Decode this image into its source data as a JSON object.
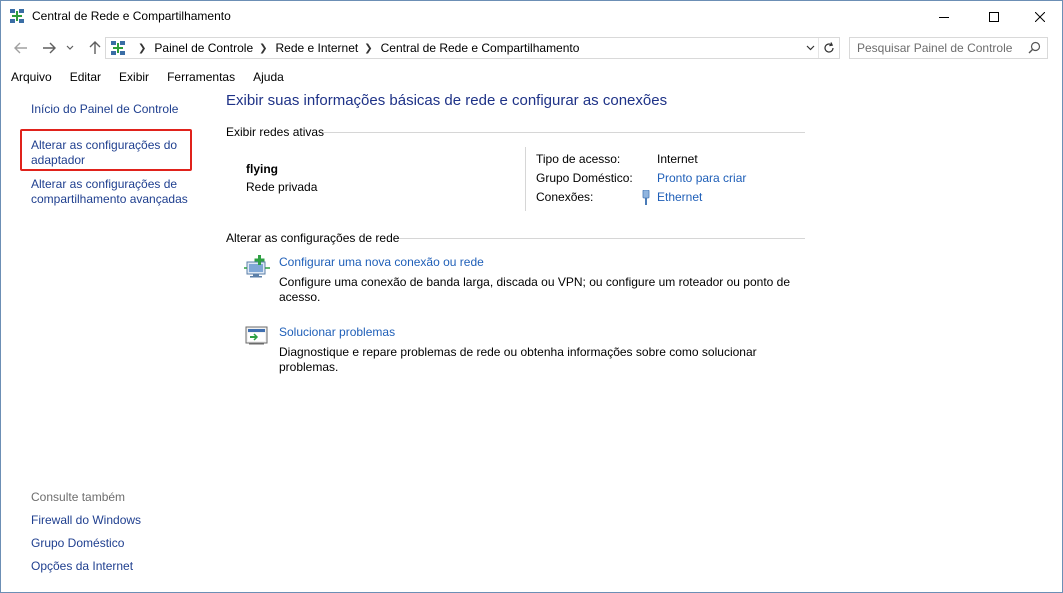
{
  "window": {
    "title": "Central de Rede e Compartilhamento"
  },
  "address": {
    "crumbs": [
      "Painel de Controle",
      "Rede e Internet",
      "Central de Rede e Compartilhamento"
    ]
  },
  "search": {
    "placeholder": "Pesquisar Painel de Controle"
  },
  "menu": {
    "items": [
      "Arquivo",
      "Editar",
      "Exibir",
      "Ferramentas",
      "Ajuda"
    ]
  },
  "sidebar": {
    "home": "Início do Painel de Controle",
    "adapter": "Alterar as configurações do adaptador",
    "sharing": "Alterar as configurações de compartilhamento avançadas",
    "see_also_title": "Consulte também",
    "see_also": [
      "Firewall do Windows",
      "Grupo Doméstico",
      "Opções da Internet"
    ]
  },
  "main": {
    "title": "Exibir suas informações básicas de rede e configurar as conexões",
    "active_header": "Exibir redes ativas",
    "network": {
      "name": "flying",
      "type": "Rede privada",
      "access_label": "Tipo de acesso:",
      "access_value": "Internet",
      "homegroup_label": "Grupo Doméstico:",
      "homegroup_value": "Pronto para criar",
      "connections_label": "Conexões:",
      "connections_value": "Ethernet"
    },
    "change_header": "Alterar as configurações de rede",
    "tasks": [
      {
        "link": "Configurar uma nova conexão ou rede",
        "desc": "Configure uma conexão de banda larga, discada ou VPN; ou configure um roteador ou ponto de acesso.",
        "icon": "new-connection-icon"
      },
      {
        "link": "Solucionar problemas",
        "desc": "Diagnostique e repare problemas de rede ou obtenha informações sobre como solucionar problemas.",
        "icon": "troubleshoot-icon"
      }
    ]
  },
  "colors": {
    "link": "#1f5fb8",
    "title": "#1e3287",
    "highlight": "#e0221b"
  }
}
